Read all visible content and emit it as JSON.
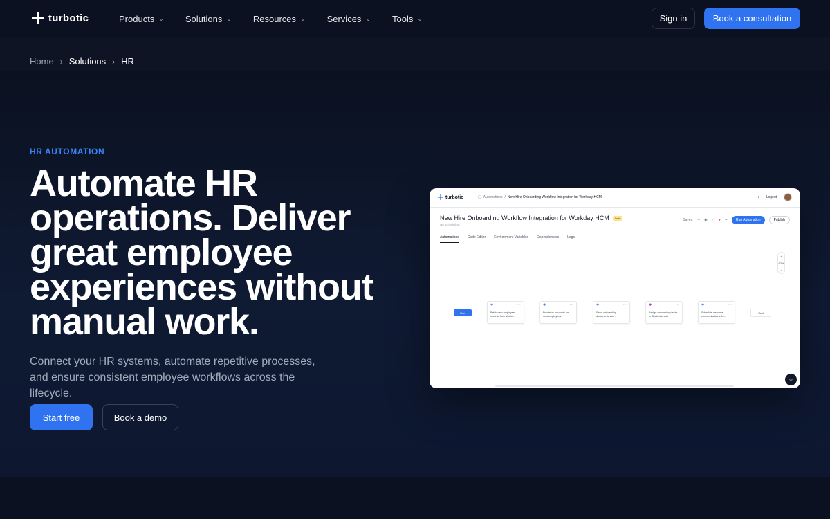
{
  "nav": {
    "logo_text": "turbotic",
    "items": [
      {
        "label": "Products"
      },
      {
        "label": "Solutions"
      },
      {
        "label": "Resources"
      },
      {
        "label": "Services"
      },
      {
        "label": "Tools"
      }
    ],
    "signin_label": "Sign in",
    "consult_label": "Book a consultation"
  },
  "breadcrumb": {
    "items": [
      "Home",
      "Solutions",
      "HR"
    ]
  },
  "hero": {
    "eyebrow": "HR AUTOMATION",
    "headline": "Automate HR operations. Deliver great employee experiences without manual work.",
    "subtitle": "Connect your HR systems, automate repetitive processes, and ensure consistent employee workflows across the lifecycle.",
    "start_label": "Start free",
    "demo_label": "Book a demo"
  },
  "preview": {
    "logo_text": "turbotic",
    "crumb_root": "Automations",
    "crumb_sep": "/",
    "crumb_current": "New Hire Onboarding Workflow Integration for Workday HCM",
    "logout_label": "Logout",
    "title": "New Hire Onboarding Workflow Integration for Workday HCM",
    "draft_badge": "Draft",
    "schedule_text": "No scheduling",
    "saved_text": "Saved",
    "run_label": "Run Automation",
    "publish_label": "Publish",
    "tabs": [
      "Automations",
      "Code Editor",
      "Environment Variables",
      "Dependencies",
      "Logs"
    ],
    "zoom_level": "92%",
    "start_node": "Start",
    "end_node": "End",
    "nodes": [
      "Fetch new employee records from Workd...",
      "Provision accounts for new employees",
      "Send onboarding documents via...",
      "Assign onboarding tasks in Slack channel",
      "Schedule welcome communications for..."
    ]
  },
  "colors": {
    "accent": "#2f73f0",
    "background": "#0b1120",
    "eyebrow": "#3b82f6"
  }
}
